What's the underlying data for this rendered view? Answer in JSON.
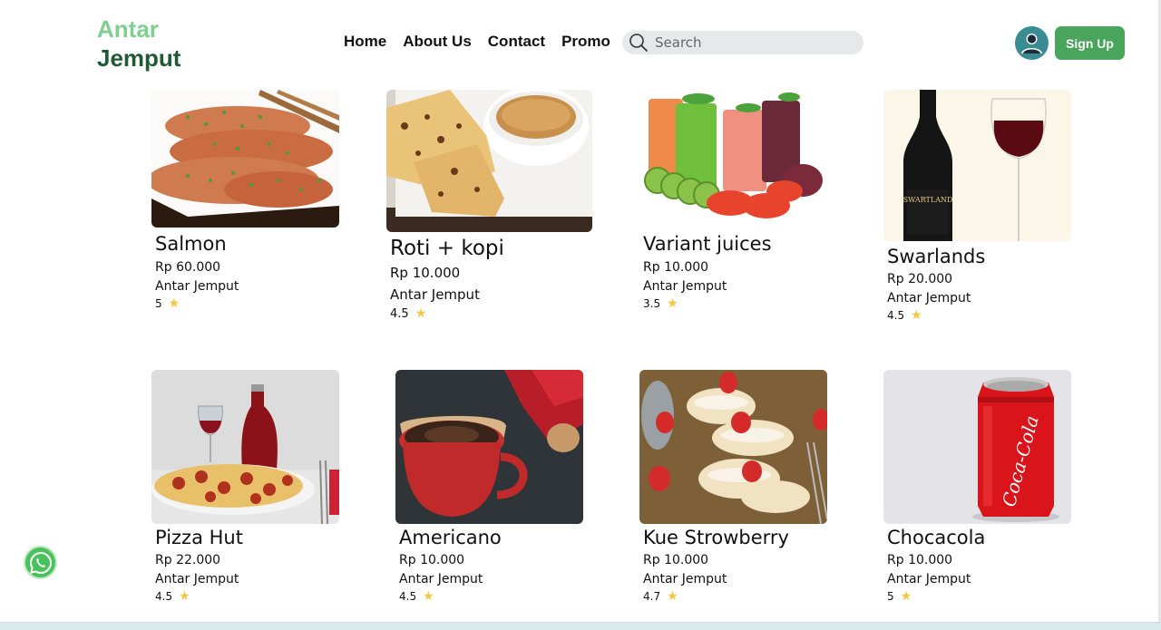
{
  "brand": {
    "line1": "Antar",
    "line2": "Jemput"
  },
  "nav": {
    "items": [
      "Home",
      "About Us",
      "Contact",
      "Promo"
    ]
  },
  "search": {
    "placeholder": "Search",
    "icon": "search-icon"
  },
  "header": {
    "signup_label": "Sign Up",
    "avatar_icon": "user-icon"
  },
  "colors": {
    "brand_light": "#7fcf8f",
    "brand_dark": "#1f5a34",
    "button_green": "#4aa55c",
    "star": "#f2c744"
  },
  "products": [
    {
      "name": "Salmon",
      "price": "Rp 60.000",
      "store": "Antar Jemput",
      "rating": "5"
    },
    {
      "name": "Roti + kopi",
      "price": "Rp 10.000",
      "store": "Antar Jemput",
      "rating": "4.5"
    },
    {
      "name": "Variant juices",
      "price": "Rp 10.000",
      "store": "Antar Jemput",
      "rating": "3.5"
    },
    {
      "name": "Swarlands",
      "price": "Rp 20.000",
      "store": "Antar Jemput",
      "rating": "4.5"
    },
    {
      "name": "Pizza Hut",
      "price": "Rp 22.000",
      "store": "Antar Jemput",
      "rating": "4.5"
    },
    {
      "name": "Americano",
      "price": "Rp 10.000",
      "store": "Antar Jemput",
      "rating": "4.5"
    },
    {
      "name": "Kue Strowberry",
      "price": "Rp 10.000",
      "store": "Antar Jemput",
      "rating": "4.7"
    },
    {
      "name": "Chocacola",
      "price": "Rp 10.000",
      "store": "Antar Jemput",
      "rating": "5"
    }
  ],
  "product_labels": {
    "swartland_bottle": "SWARTLAND",
    "cola_can": "Coca-Cola"
  },
  "floating": {
    "whatsapp_icon": "whatsapp-icon"
  }
}
